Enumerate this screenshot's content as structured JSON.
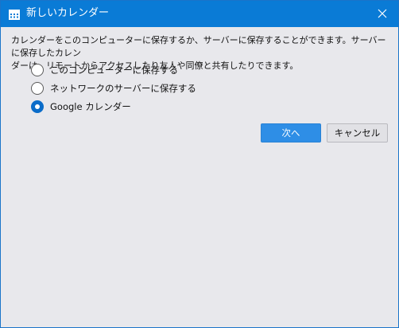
{
  "window": {
    "title": "新しいカレンダー",
    "title_icon": "calendar-icon",
    "close_icon": "close-icon"
  },
  "dialog": {
    "description_line1": "カレンダーをこのコンピューターに保存するか、サーバーに保存することができます。サーバーに保存したカレン",
    "description_line2": "ダーは、リモートからアクセスしたり友人や同僚と共有したりできます。",
    "options": [
      {
        "label": "このコンピューターに保存する",
        "checked": false
      },
      {
        "label": "ネットワークのサーバーに保存する",
        "checked": false
      },
      {
        "label": "Google カレンダー",
        "checked": true
      }
    ],
    "buttons": {
      "next_label": "次へ",
      "cancel_label": "キャンセル"
    }
  },
  "colors": {
    "titlebar": "#0a7bd6",
    "accent": "#0a6cc9",
    "primary_button": "#2e8ee6",
    "background": "#e8e8ec"
  }
}
